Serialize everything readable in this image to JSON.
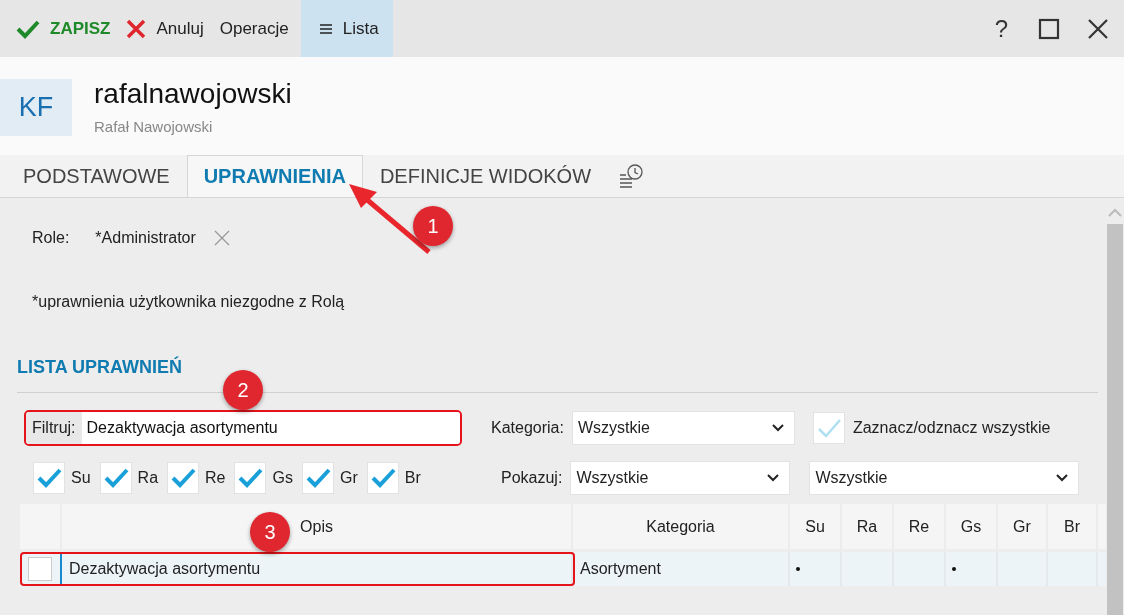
{
  "toolbar": {
    "buttons": [
      {
        "label": "ZAPISZ",
        "kind": "save",
        "selected": false
      },
      {
        "label": "Anuluj",
        "kind": "cancel",
        "selected": false
      },
      {
        "label": "Operacje",
        "kind": "plain",
        "selected": false
      },
      {
        "label": "Lista",
        "kind": "list",
        "selected": true
      }
    ],
    "help": "?"
  },
  "header": {
    "avatar": "KF",
    "username": "rafalnawojowski",
    "full_name": "Rafał Nawojowski"
  },
  "tabs": [
    {
      "label": "PODSTAWOWE",
      "selected": false
    },
    {
      "label": "UPRAWNIENIA",
      "selected": true
    },
    {
      "label": "DEFINICJE WIDOKÓW",
      "selected": false
    }
  ],
  "roles": {
    "label": "Role:",
    "value": "*Administrator"
  },
  "note": "*uprawnienia użytkownika niezgodne z Rolą",
  "section_title": "LISTA UPRAWNIEŃ",
  "filter": {
    "label": "Filtruj:",
    "value": "Dezaktywacja asortymentu"
  },
  "category": {
    "label": "Kategoria:",
    "value": "Wszystkie"
  },
  "select_all": {
    "label": "Zaznacz/odznacz wszystkie"
  },
  "rights_checks": [
    {
      "label": "Su",
      "checked": true
    },
    {
      "label": "Ra",
      "checked": true
    },
    {
      "label": "Re",
      "checked": true
    },
    {
      "label": "Gs",
      "checked": true
    },
    {
      "label": "Gr",
      "checked": true
    },
    {
      "label": "Br",
      "checked": true
    }
  ],
  "show": {
    "label": "Pokazuj:",
    "values": [
      "Wszystkie",
      "Wszystkie"
    ]
  },
  "table": {
    "columns": [
      "Opis",
      "Kategoria",
      "Su",
      "Ra",
      "Re",
      "Gs",
      "Gr",
      "Br"
    ],
    "rows": [
      {
        "checked": false,
        "selected": true,
        "opis": "Dezaktywacja asortymentu",
        "kategoria": "Asortyment",
        "flags": [
          true,
          false,
          false,
          true,
          false,
          false
        ]
      }
    ]
  },
  "annotations": [
    {
      "label": "1"
    },
    {
      "label": "2"
    },
    {
      "label": "3"
    }
  ]
}
